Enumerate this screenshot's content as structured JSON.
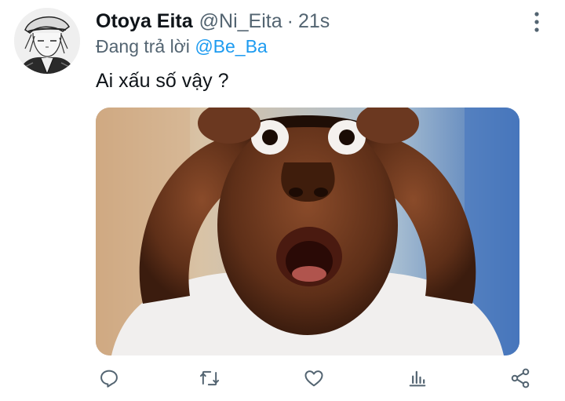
{
  "tweet": {
    "display_name": "Otoya Eita",
    "handle": "@Ni_Eita",
    "separator": "·",
    "time": "21s",
    "reply_prefix": "Đang trả lời",
    "reply_mention": "@Be_Ba",
    "text": "Ai xấu số vậy ?"
  },
  "icons": {
    "more": "more-vertical-icon",
    "reply": "reply-icon",
    "retweet": "retweet-icon",
    "like": "heart-icon",
    "analytics": "analytics-icon",
    "share": "share-icon"
  },
  "colors": {
    "text": "#0f1419",
    "secondary": "#536471",
    "mention": "#1d9bf0"
  }
}
